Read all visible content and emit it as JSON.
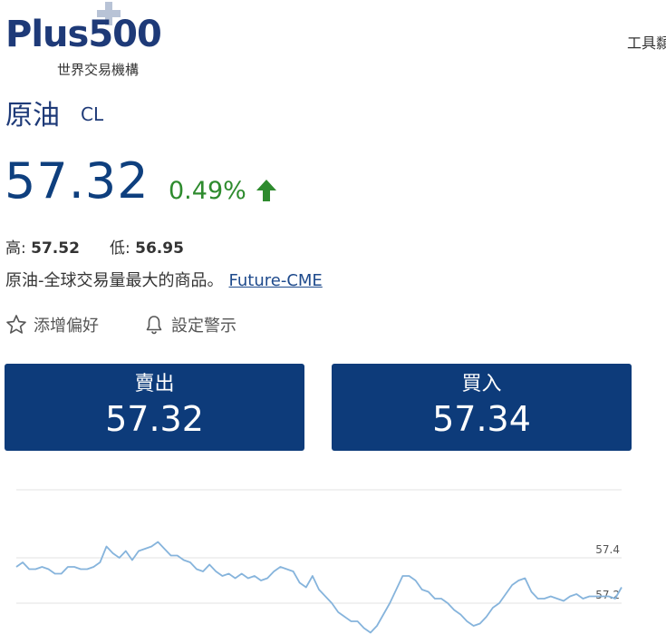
{
  "header": {
    "logo_text": "Plus500",
    "logo_subtitle": "世界交易機構",
    "tools_link": "工具纇"
  },
  "instrument": {
    "name": "原油",
    "symbol": "CL",
    "price": "57.32",
    "change": "0.49%",
    "change_direction": "up",
    "high_label": "高:",
    "high_value": "57.52",
    "low_label": "低:",
    "low_value": "56.95",
    "description": "原油-全球交易量最大的商品。",
    "exchange_link": "Future-CME"
  },
  "actions": {
    "favorite_label": "添增偏好",
    "alert_label": "設定警示"
  },
  "trade": {
    "sell_label": "賣出",
    "sell_price": "57.32",
    "buy_label": "買入",
    "buy_price": "57.34"
  },
  "colors": {
    "brand": "#0d3b7a",
    "positive": "#2e8b2e",
    "line": "#86b4dc"
  },
  "chart_data": {
    "type": "line",
    "y_ticks": [
      "57.4",
      "57.2"
    ],
    "y_tick_values": [
      57.4,
      57.2
    ],
    "ylim": [
      57.1,
      57.7
    ],
    "grid": true,
    "values": [
      57.36,
      57.38,
      57.35,
      57.35,
      57.36,
      57.35,
      57.33,
      57.33,
      57.36,
      57.36,
      57.35,
      57.35,
      57.36,
      57.38,
      57.45,
      57.42,
      57.4,
      57.43,
      57.39,
      57.43,
      57.44,
      57.45,
      57.47,
      57.44,
      57.41,
      57.41,
      57.39,
      57.38,
      57.35,
      57.34,
      57.37,
      57.34,
      57.32,
      57.33,
      57.31,
      57.33,
      57.31,
      57.32,
      57.3,
      57.31,
      57.34,
      57.36,
      57.35,
      57.34,
      57.29,
      57.27,
      57.32,
      57.26,
      57.23,
      57.2,
      57.16,
      57.14,
      57.12,
      57.12,
      57.09,
      57.07,
      57.1,
      57.15,
      57.2,
      57.26,
      57.32,
      57.32,
      57.3,
      57.26,
      57.25,
      57.22,
      57.22,
      57.2,
      57.17,
      57.15,
      57.12,
      57.1,
      57.11,
      57.14,
      57.18,
      57.2,
      57.24,
      57.28,
      57.3,
      57.31,
      57.25,
      57.22,
      57.22,
      57.23,
      57.22,
      57.21,
      57.23,
      57.24,
      57.22,
      57.23,
      57.23,
      57.23,
      57.23,
      57.22,
      57.27
    ]
  }
}
